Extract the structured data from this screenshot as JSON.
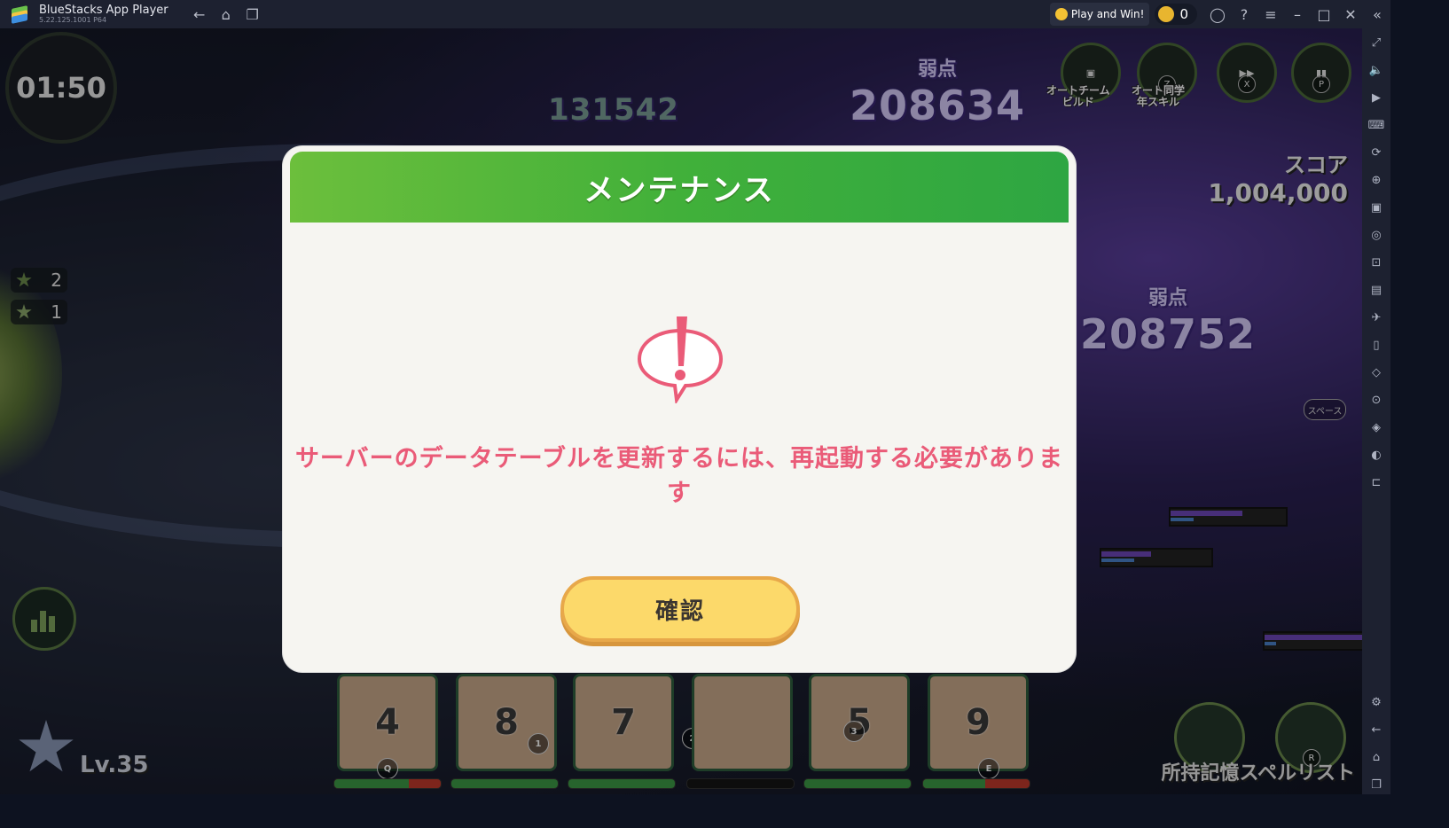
{
  "titlebar": {
    "app_name": "BlueStacks App Player",
    "version": "5.22.125.1001  P64",
    "play_label": "Play and Win!",
    "coin_count": "0"
  },
  "game": {
    "timer": "01:50",
    "stat1": "2",
    "stat2": "1",
    "weak_label": "弱点",
    "weak_top": "208634",
    "weak_mid": "208752",
    "damage_partial": "131542",
    "score_label": "スコア",
    "score_value": "1,004,000",
    "auto_team_label": "オートチーム\nビルド",
    "auto_skill_label": "オート同学\n年スキル",
    "key_z": "Z",
    "key_x": "X",
    "key_p": "P",
    "space_label": "スペース",
    "level": "Lv.35",
    "spell_list": "所持記憶スペルリスト",
    "cards": [
      {
        "num": "4",
        "key": "Q"
      },
      {
        "num": "8",
        "key": "1"
      },
      {
        "num": "7",
        "key": "2"
      },
      {
        "num": "",
        "key": ""
      },
      {
        "num": "5",
        "key": "3"
      },
      {
        "num": "9",
        "key": "E"
      }
    ],
    "card_bars": [
      0.7,
      1.0,
      1.0,
      0.0,
      1.0,
      0.58
    ],
    "skill_key_r": "R"
  },
  "dialog": {
    "title": "メンテナンス",
    "message": "サーバーのデータテーブルを更新するには、再起動する必要があります",
    "confirm_label": "確認"
  },
  "colors": {
    "header_green": "#41b03a",
    "message_pink": "#ea5b78",
    "button_yellow": "#fcd96a"
  }
}
